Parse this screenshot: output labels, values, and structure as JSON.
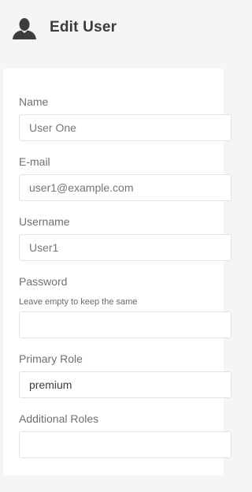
{
  "header": {
    "title": "Edit User",
    "icon": "user-icon"
  },
  "form": {
    "name": {
      "label": "Name",
      "placeholder": "User One"
    },
    "email": {
      "label": "E-mail",
      "placeholder": "user1@example.com"
    },
    "username": {
      "label": "Username",
      "placeholder": "User1"
    },
    "password": {
      "label": "Password",
      "hint": "Leave empty to keep the same",
      "value": ""
    },
    "primary_role": {
      "label": "Primary Role",
      "value": "premium"
    },
    "additional_roles": {
      "label": "Additional Roles",
      "value": ""
    }
  },
  "colors": {
    "background": "#f5f5f5",
    "card": "#ffffff",
    "title": "#3a3a3a",
    "icon": "#3d3d3d"
  }
}
